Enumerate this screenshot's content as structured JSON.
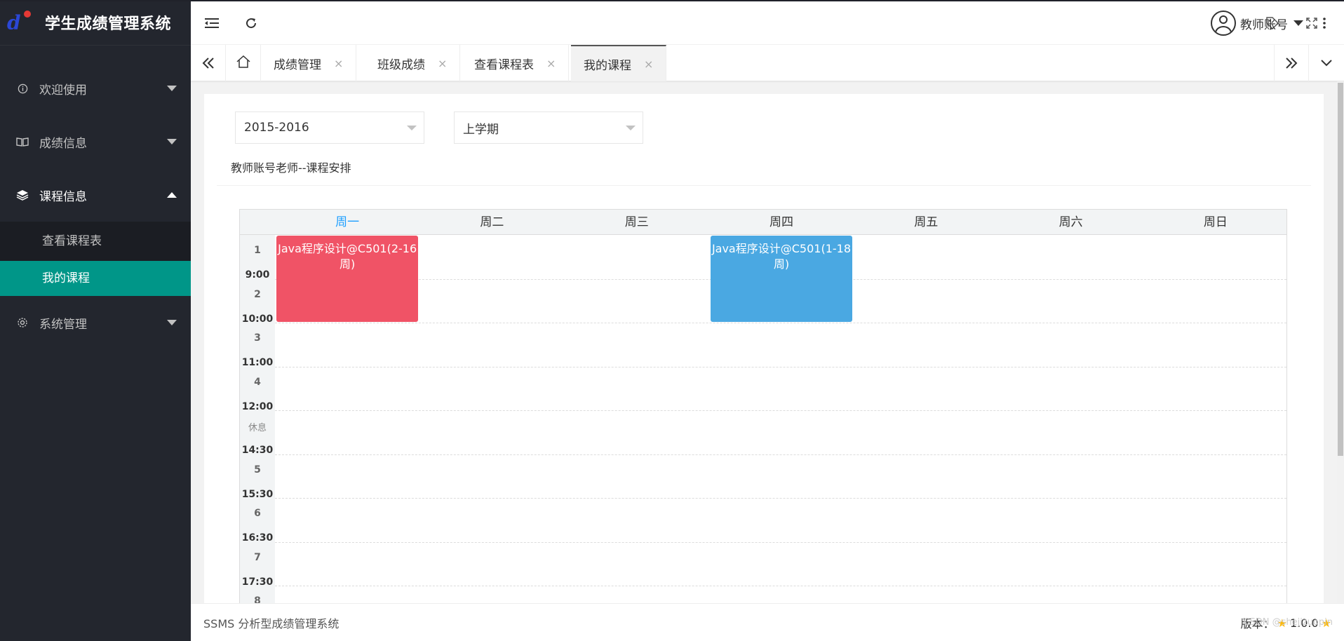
{
  "app": {
    "title": "学生成绩管理系统"
  },
  "sidebar": {
    "items": [
      {
        "label": "欢迎使用",
        "icon": "info-circle-icon"
      },
      {
        "label": "成绩信息",
        "icon": "book-icon"
      },
      {
        "label": "课程信息",
        "icon": "layers-icon",
        "open": true,
        "children": [
          {
            "label": "查看课程表"
          },
          {
            "label": "我的课程",
            "active": true
          }
        ]
      },
      {
        "label": "系统管理",
        "icon": "gear-icon"
      }
    ]
  },
  "header": {
    "user_name": "教师账号",
    "icons": [
      "menu-fold-icon",
      "refresh-icon",
      "tag-icon",
      "fullscreen-icon",
      "more-vertical-icon"
    ]
  },
  "tabs": {
    "items": [
      {
        "label": "成绩管理",
        "close": "×"
      },
      {
        "label": "班级成绩",
        "close": "×"
      },
      {
        "label": "查看课程表",
        "close": "×"
      },
      {
        "label": "我的课程",
        "close": "×",
        "active": true
      }
    ]
  },
  "filters": {
    "year": "2015-2016",
    "term": "上学期"
  },
  "schedule": {
    "title": "教师账号老师--课程安排",
    "days": [
      "周一",
      "周二",
      "周三",
      "周四",
      "周五",
      "周六",
      "周日"
    ],
    "today_index": 0,
    "rows": [
      {
        "num": "1",
        "time": "9:00"
      },
      {
        "num": "2",
        "time": "10:00"
      },
      {
        "num": "3",
        "time": "11:00"
      },
      {
        "num": "4",
        "time": "12:00"
      },
      {
        "num": "休息",
        "time": "14:30"
      },
      {
        "num": "5",
        "time": "15:30"
      },
      {
        "num": "6",
        "time": "16:30"
      },
      {
        "num": "7",
        "time": "17:30"
      },
      {
        "num": "8",
        "time": ""
      }
    ],
    "courses": [
      {
        "text": "Java程序设计@C501(2-16周)",
        "day": "周一",
        "periods": "1-2",
        "color": "#f05366"
      },
      {
        "text": "Java程序设计@C501(1-18周)",
        "day": "周四",
        "periods": "1-2",
        "color": "#4aa8e2"
      }
    ]
  },
  "footer": {
    "text": "SSMS 分析型成绩管理系统",
    "version_label": "版本：",
    "version": "1.0.0",
    "watermark": "CSDN @shejizuopin"
  },
  "colors": {
    "sidebar_bg": "#23262e",
    "active_green": "#009688",
    "today_blue": "#1e9fff"
  }
}
